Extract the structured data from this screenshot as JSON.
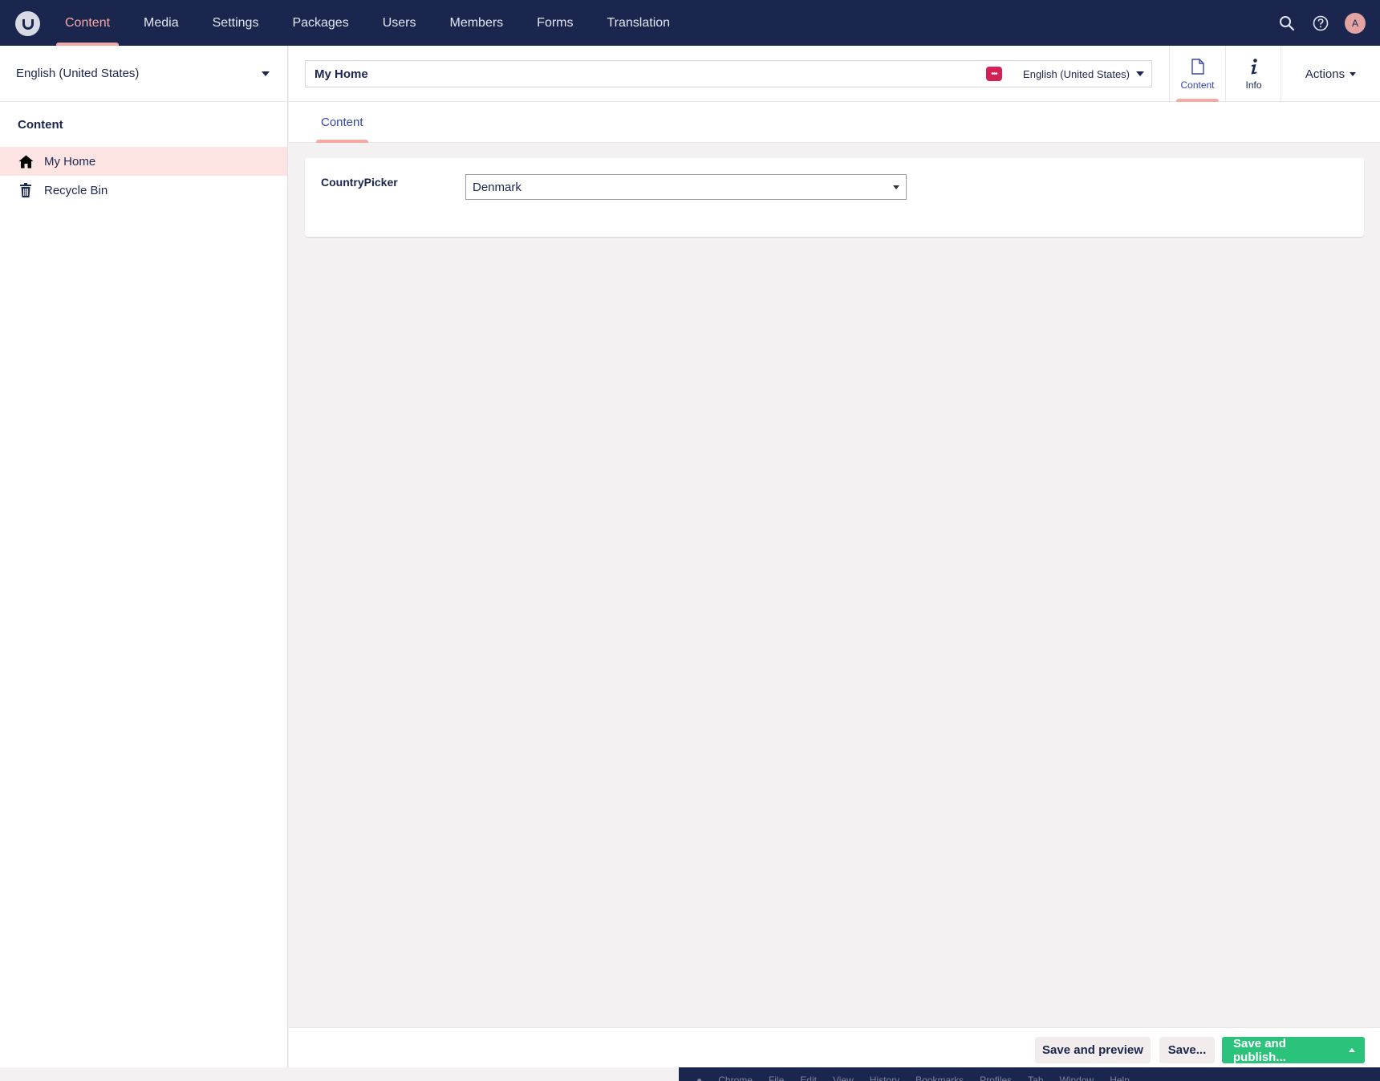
{
  "topnav": {
    "items": [
      {
        "label": "Content",
        "active": true
      },
      {
        "label": "Media"
      },
      {
        "label": "Settings"
      },
      {
        "label": "Packages"
      },
      {
        "label": "Users"
      },
      {
        "label": "Members"
      },
      {
        "label": "Forms"
      },
      {
        "label": "Translation"
      }
    ],
    "avatar_initial": "A",
    "icons": [
      "search-icon",
      "help-icon"
    ]
  },
  "sidebar": {
    "language": "English (United States)",
    "section_title": "Content",
    "items": [
      {
        "label": "My Home",
        "icon": "home-icon",
        "selected": true
      },
      {
        "label": "Recycle Bin",
        "icon": "trash-icon"
      }
    ]
  },
  "editor": {
    "name_value": "My Home",
    "variant_label": "English (United States)",
    "app_tabs": [
      {
        "label": "Content",
        "icon": "document-icon",
        "active": true
      },
      {
        "label": "Info",
        "icon": "info-icon"
      }
    ],
    "actions_label": "Actions",
    "content_tab_label": "Content",
    "property": {
      "label": "CountryPicker",
      "selected_value": "Denmark"
    }
  },
  "footer": {
    "save_preview_label": "Save and preview",
    "save_label": "Save...",
    "save_publish_label": "Save and publish..."
  },
  "osbar": {
    "items": [
      "Chrome",
      "File",
      "Edit",
      "View",
      "History",
      "Bookmarks",
      "Profiles",
      "Tab",
      "Window",
      "Help"
    ]
  },
  "colors": {
    "topbar": "#1b264f",
    "accent_pink": "#f5a9a2",
    "selected_bg": "#fde4e2",
    "publish_green": "#2bc37c",
    "status_red": "#d42054"
  }
}
